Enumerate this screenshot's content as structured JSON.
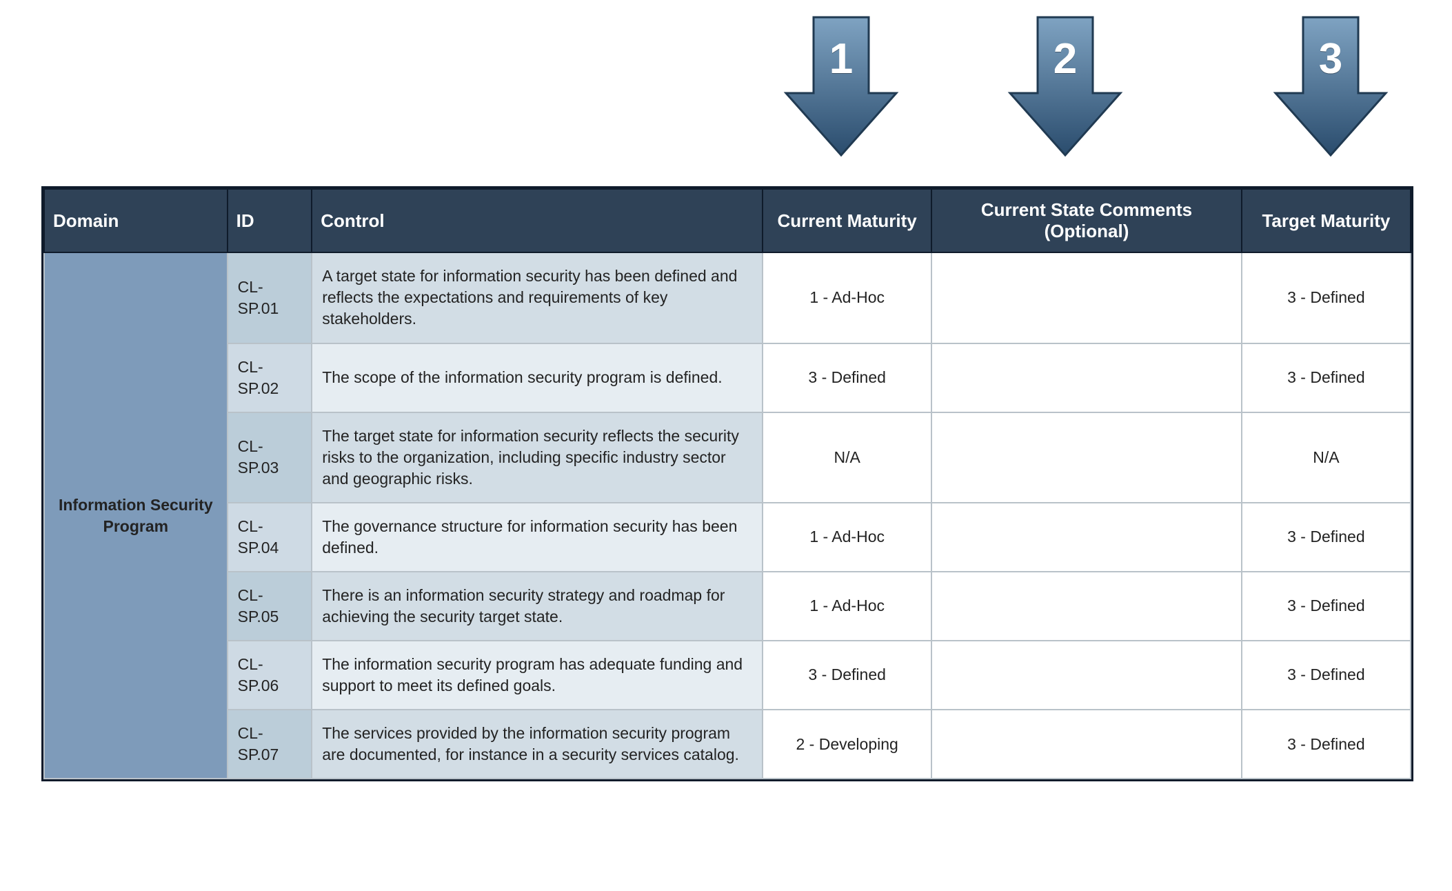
{
  "arrows": {
    "labels": [
      "1",
      "2",
      "3"
    ]
  },
  "colors": {
    "header_bg": "#2f4257",
    "domain_bg": "#7e9bba",
    "id_bg_light": "#cedae4",
    "id_bg_dark": "#bbcdd9",
    "control_bg_light": "#e6edf2",
    "control_bg_dark": "#d2dde5",
    "border": "#0f1b2b",
    "arrow_top": "#7fa3c2",
    "arrow_bottom": "#2a4c6d"
  },
  "table": {
    "headers": {
      "domain": "Domain",
      "id": "ID",
      "control": "Control",
      "current_maturity": "Current Maturity",
      "comments": "Current State Comments (Optional)",
      "target_maturity": "Target Maturity"
    },
    "domain_label": "Information Security Program",
    "rows": [
      {
        "id": "CL-SP.01",
        "control": "A target state for information security has been defined and reflects the expectations and requirements of key stakeholders.",
        "current": "1 - Ad-Hoc",
        "comments": "",
        "target": "3 - Defined"
      },
      {
        "id": "CL-SP.02",
        "control": "The scope of the information security program is defined.",
        "current": "3 - Defined",
        "comments": "",
        "target": "3 - Defined"
      },
      {
        "id": "CL-SP.03",
        "control": "The target state for information security reflects the security risks to the organization, including specific industry sector and geographic risks.",
        "current": "N/A",
        "comments": "",
        "target": "N/A"
      },
      {
        "id": "CL-SP.04",
        "control": "The governance structure for information security has been defined.",
        "current": "1 - Ad-Hoc",
        "comments": "",
        "target": "3 - Defined"
      },
      {
        "id": "CL-SP.05",
        "control": "There is an information security strategy and roadmap for achieving the security target state.",
        "current": "1 - Ad-Hoc",
        "comments": "",
        "target": "3 - Defined"
      },
      {
        "id": "CL-SP.06",
        "control": "The information security program has adequate funding and support to meet its defined goals.",
        "current": "3 - Defined",
        "comments": "",
        "target": "3 - Defined"
      },
      {
        "id": "CL-SP.07",
        "control": "The services provided by the information security program are documented, for instance in a security services catalog.",
        "current": "2 - Developing",
        "comments": "",
        "target": "3 - Defined"
      }
    ]
  }
}
